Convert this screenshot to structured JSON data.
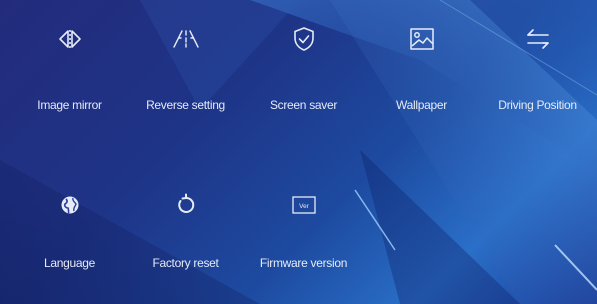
{
  "settings": {
    "items": [
      {
        "label": "Image mirror",
        "icon": "mirror-icon"
      },
      {
        "label": "Reverse setting",
        "icon": "reverse-guide-icon"
      },
      {
        "label": "Screen saver",
        "icon": "shield-check-icon"
      },
      {
        "label": "Wallpaper",
        "icon": "image-icon"
      },
      {
        "label": "Driving Position",
        "icon": "swap-arrows-icon"
      },
      {
        "label": "Language",
        "icon": "globe-icon"
      },
      {
        "label": "Factory reset",
        "icon": "reset-icon"
      },
      {
        "label": "Firmware version",
        "icon": "ver-badge-icon",
        "badge_text": "Ver"
      }
    ]
  },
  "colors": {
    "icon": "#e6ebf7",
    "label": "#e6ebf7",
    "background_dark": "#232b7c",
    "background_light": "#2a6fc8"
  }
}
